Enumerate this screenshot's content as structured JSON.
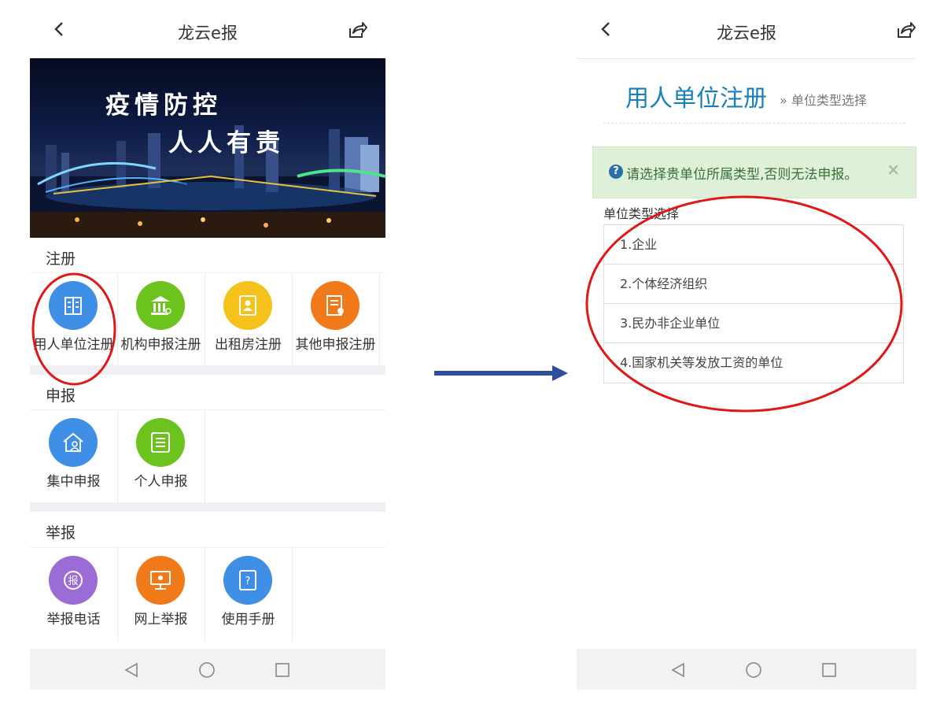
{
  "left_screen": {
    "header": {
      "title": "龙云e报"
    },
    "banner": {
      "line1": "疫情防控",
      "line2": "人人有责"
    },
    "sections": [
      {
        "title": "注册",
        "items": [
          {
            "label": "用人单位注册",
            "icon": "building-icon",
            "color": "#3f8fe6"
          },
          {
            "label": "机构申报注册",
            "icon": "institution-icon",
            "color": "#6cc31e"
          },
          {
            "label": "出租房注册",
            "icon": "id-card-icon",
            "color": "#f4c21a"
          },
          {
            "label": "其他申报注册",
            "icon": "document-stamp-icon",
            "color": "#f07a1a"
          }
        ]
      },
      {
        "title": "申报",
        "items": [
          {
            "label": "集中申报",
            "icon": "house-person-icon",
            "color": "#3f8fe6"
          },
          {
            "label": "个人申报",
            "icon": "list-icon",
            "color": "#6cc31e"
          }
        ]
      },
      {
        "title": "举报",
        "items": [
          {
            "label": "举报电话",
            "icon": "report-phone-icon",
            "color": "#9b6cd6"
          },
          {
            "label": "网上举报",
            "icon": "monitor-icon",
            "color": "#f07a1a"
          },
          {
            "label": "使用手册",
            "icon": "manual-book-icon",
            "color": "#3f8fe6"
          }
        ]
      }
    ]
  },
  "right_screen": {
    "header": {
      "title": "龙云e报"
    },
    "page_title": "用人单位注册",
    "breadcrumb": "» 单位类型选择",
    "alert": {
      "icon": "question-icon",
      "message": "请选择贵单位所属类型,否则无法申报。",
      "close": "×"
    },
    "field_label": "单位类型选择",
    "options": [
      "1.企业",
      "2.个体经济组织",
      "3.民办非企业单位",
      "4.国家机关等发放工资的单位"
    ]
  },
  "colors": {
    "accent_blue": "#1a7fb9",
    "alert_bg": "#dff0d8",
    "annotation_red": "#e01818",
    "arrow_blue": "#2f4f9a"
  }
}
